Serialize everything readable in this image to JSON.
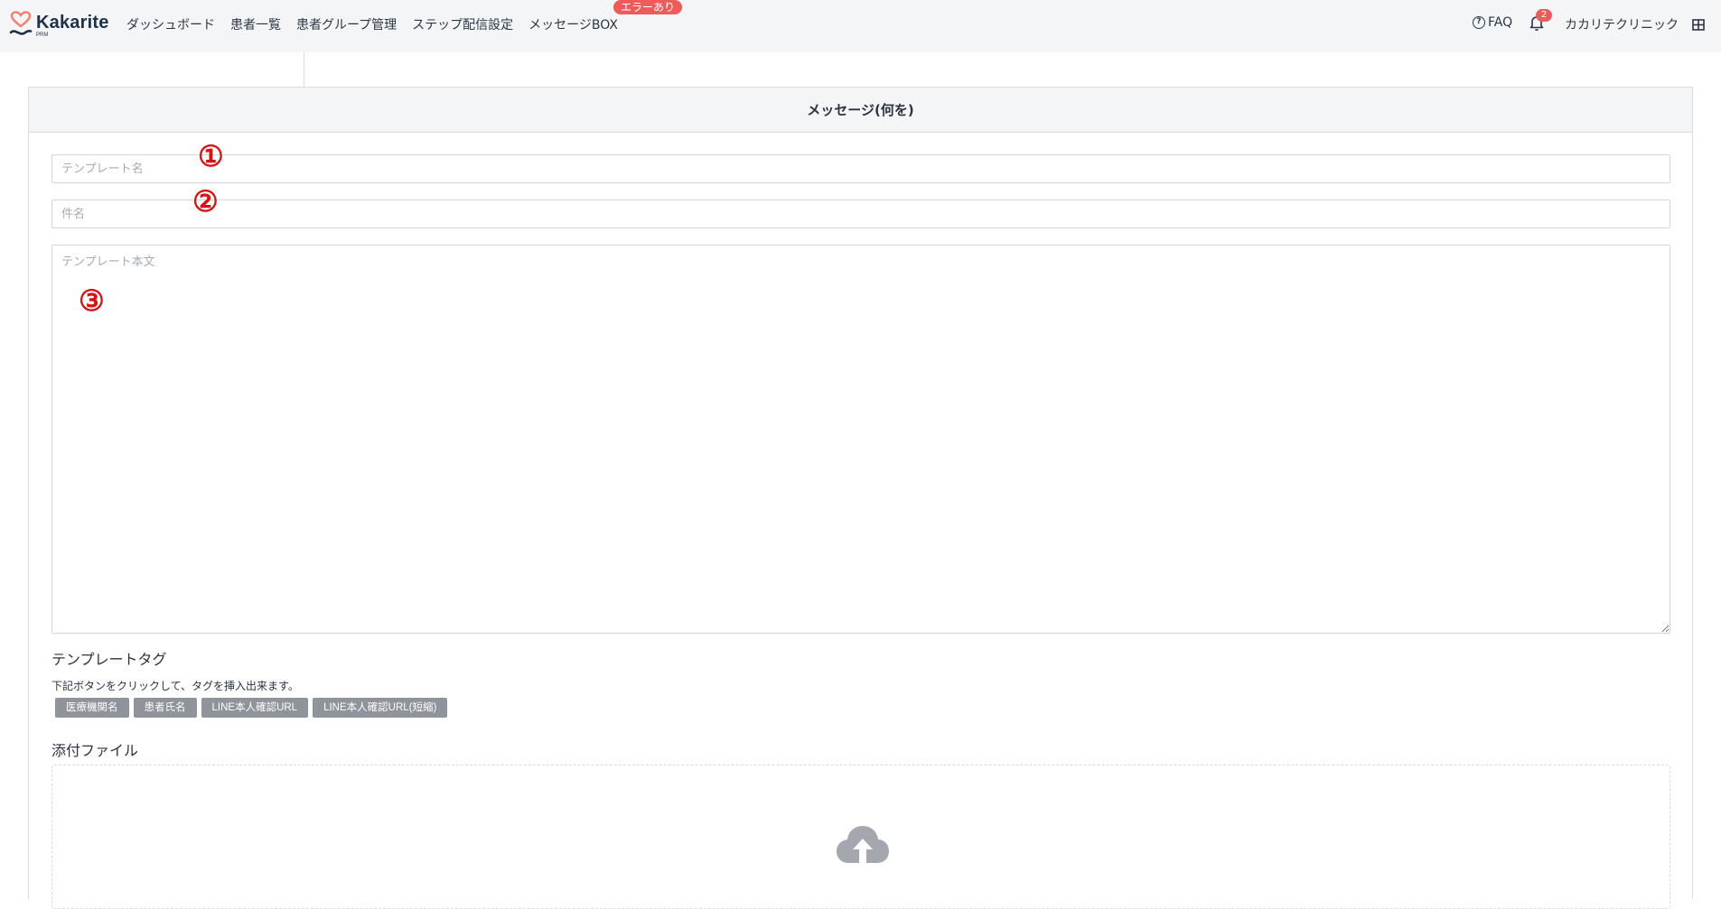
{
  "app": {
    "brand": "Kakarite",
    "brand_sub": "PRM"
  },
  "nav": {
    "items": [
      "ダッシュボード",
      "患者一覧",
      "患者グループ管理",
      "ステップ配信設定",
      "メッセージBOX"
    ],
    "error_badge": "エラーあり"
  },
  "header_right": {
    "faq": "FAQ",
    "notification_count": "2",
    "clinic_name": "カカリテクリニック"
  },
  "panel": {
    "title": "メッセージ(何を)"
  },
  "form": {
    "template_name_placeholder": "テンプレート名",
    "subject_placeholder": "件名",
    "body_placeholder": "テンプレート本文",
    "markers": [
      "①",
      "②",
      "③"
    ]
  },
  "template_tags": {
    "title": "テンプレートタグ",
    "help": "下記ボタンをクリックして、タグを挿入出来ます。",
    "buttons": [
      "医療機関名",
      "患者氏名",
      "LINE本人確認URL",
      "LINE本人確認URL(短縮)"
    ]
  },
  "attachments": {
    "title": "添付ファイル"
  },
  "colors": {
    "brand": "#1f3147",
    "accent_heart": "#f08070",
    "badge": "#ef5a5a",
    "marker": "#d61414",
    "tag_button": "#8f949b"
  }
}
